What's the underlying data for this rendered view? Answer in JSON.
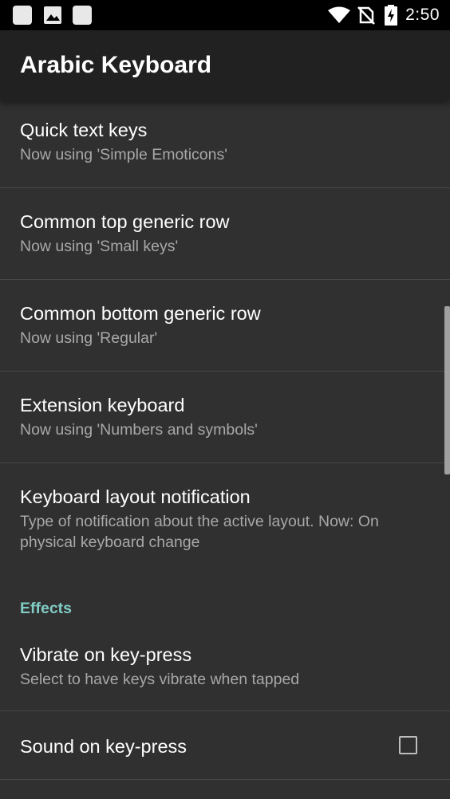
{
  "status_bar": {
    "time": "2:50",
    "left_icons": [
      "notification-square-icon",
      "image-icon",
      "notification-square-icon"
    ],
    "right_icons": [
      "wifi-icon",
      "no-sim-icon",
      "battery-charging-icon"
    ]
  },
  "app_bar": {
    "title": "Arabic Keyboard"
  },
  "preferences": [
    {
      "title": "Quick text keys",
      "summary": "Now using 'Simple Emoticons'"
    },
    {
      "title": "Common top generic row",
      "summary": "Now using 'Small keys'"
    },
    {
      "title": "Common bottom generic row",
      "summary": "Now using 'Regular'"
    },
    {
      "title": "Extension keyboard",
      "summary": "Now using 'Numbers and symbols'"
    },
    {
      "title": "Keyboard layout notification",
      "summary": "Type of notification about the active layout. Now: On physical keyboard change"
    }
  ],
  "effects": {
    "header": "Effects",
    "items": [
      {
        "title": "Vibrate on key-press",
        "summary": "Select to have keys vibrate when tapped"
      },
      {
        "title": "Sound on key-press",
        "checked": false
      }
    ]
  },
  "colors": {
    "accent": "#80cbc4",
    "background": "#303030",
    "app_bar": "#212121"
  }
}
